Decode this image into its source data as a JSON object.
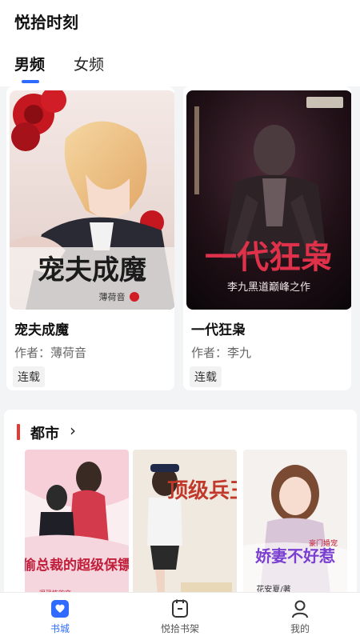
{
  "header": {
    "title": "悦拾时刻"
  },
  "tabs": [
    {
      "label": "男频",
      "active": true
    },
    {
      "label": "女频",
      "active": false
    }
  ],
  "featured": [
    {
      "title": "宠夫成魔",
      "author": "作者：薄荷音",
      "status": "连载",
      "cover_title": "宠夫成魔",
      "cover_author": "薄荷音"
    },
    {
      "title": "一代狂枭",
      "author": "作者：李九",
      "status": "连载",
      "cover_title": "一代狂枭",
      "cover_subtitle": "李九黑道巅峰之作"
    }
  ],
  "section": {
    "title": "都市",
    "books": [
      {
        "cover_title": "偷总裁的超级保镖",
        "cover_author": "很恐怖的文"
      },
      {
        "cover_title": "顶级兵王",
        "cover_author": ""
      },
      {
        "cover_title": "娇妻不好惹",
        "cover_tag": "豪门婚宠",
        "cover_author": "花安夏/著"
      }
    ]
  },
  "bottom_nav": [
    {
      "label": "书城",
      "icon": "store-icon",
      "active": true
    },
    {
      "label": "悦拾书架",
      "icon": "bookshelf-icon",
      "active": false
    },
    {
      "label": "我的",
      "icon": "profile-icon",
      "active": false
    }
  ],
  "colors": {
    "accent": "#2f6bff",
    "section_marker": "#e53935"
  }
}
